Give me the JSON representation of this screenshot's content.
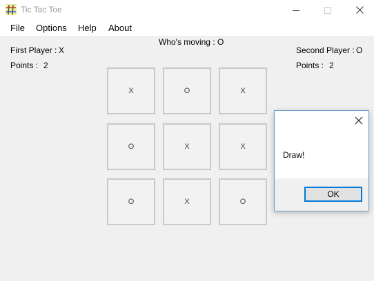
{
  "window": {
    "title": "Tic Tac Toe",
    "icon": "tic-tac-toe-app-icon"
  },
  "menu": {
    "items": [
      "File",
      "Options",
      "Help",
      "About"
    ]
  },
  "status": {
    "moving_label": "Who's moving :",
    "moving_value": "O"
  },
  "player1": {
    "label": "First Player :",
    "symbol": "X",
    "points_label": "Points :",
    "points": "2"
  },
  "player2": {
    "label": "Second Player :",
    "symbol": "O",
    "points_label": "Points :",
    "points": "2"
  },
  "board": [
    [
      "X",
      "O",
      "X"
    ],
    [
      "O",
      "X",
      "X"
    ],
    [
      "O",
      "X",
      "O"
    ]
  ],
  "dialog": {
    "message": "Draw!",
    "ok_label": "OK"
  },
  "colors": {
    "dialog_border": "#6a9bd1",
    "ok_focus_border": "#0078d7",
    "cell_border": "#c8c8c8"
  }
}
